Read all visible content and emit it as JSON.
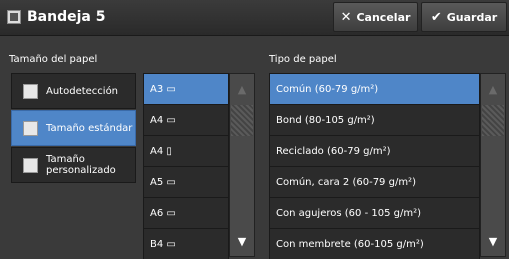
{
  "header": {
    "title": "Bandeja 5",
    "cancel_label": "Cancelar",
    "save_label": "Guardar",
    "icons": {
      "title": "tray-icon",
      "cancel": "close-icon",
      "save": "checkmark-icon"
    }
  },
  "paper_size": {
    "label": "Tamaño del papel",
    "options": [
      {
        "label": "Autodetección",
        "selected": false
      },
      {
        "label": "Tamaño estándar",
        "selected": true
      },
      {
        "label": "Tamaño personalizado",
        "selected": false
      }
    ],
    "sizes": [
      {
        "label": "A3 ▭",
        "selected": true
      },
      {
        "label": "A4 ▭",
        "selected": false
      },
      {
        "label": "A4 ▯",
        "selected": false
      },
      {
        "label": "A5 ▭",
        "selected": false
      },
      {
        "label": "A6 ▭",
        "selected": false
      },
      {
        "label": "B4 ▭",
        "selected": false
      }
    ]
  },
  "paper_type": {
    "label": "Tipo de papel",
    "items": [
      {
        "label": "Común (60-79 g/m²)",
        "selected": true
      },
      {
        "label": "Bond (80-105 g/m²)",
        "selected": false
      },
      {
        "label": "Reciclado (60-79 g/m²)",
        "selected": false
      },
      {
        "label": "Común, cara 2 (60-79 g/m²)",
        "selected": false
      },
      {
        "label": "Con agujeros (60 - 105 g/m²)",
        "selected": false
      },
      {
        "label": "Con membrete (60-105 g/m²)",
        "selected": false
      }
    ]
  },
  "colors": {
    "selected": "#4f86c8",
    "background": "#3a3a3a",
    "item": "#2b2b2b"
  }
}
